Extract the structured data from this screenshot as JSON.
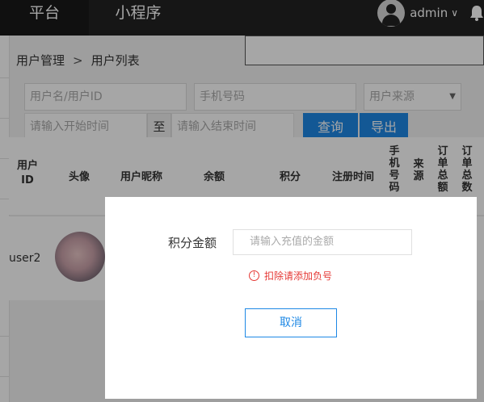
{
  "topnav": {
    "tabs": [
      {
        "label": "平台"
      },
      {
        "label": "小程序"
      }
    ],
    "user": {
      "name": "admin",
      "caret": "∨"
    }
  },
  "breadcrumb": {
    "parent": "用户管理",
    "separator": ">",
    "current": "用户列表"
  },
  "filters": {
    "username_placeholder": "用户名/用户ID",
    "phone_placeholder": "手机号码",
    "source_placeholder": "用户来源",
    "start_placeholder": "请输入开始时间",
    "to_label": "至",
    "end_placeholder": "请输入结束时间",
    "query_label": "查询",
    "export_label": "导出"
  },
  "table": {
    "headers": {
      "user_id": [
        "用户",
        "ID"
      ],
      "avatar": "头像",
      "nickname": "用户昵称",
      "balance": "余额",
      "points": "积分",
      "reg_time": "注册时间",
      "phone_v": [
        "手",
        "机",
        "号",
        "码"
      ],
      "source_v": [
        "来",
        "源"
      ],
      "order_total_v": [
        "订",
        "单",
        "总",
        "额"
      ],
      "order_count_v": [
        "订",
        "单",
        "总",
        "数"
      ]
    },
    "row": {
      "user": "user2"
    }
  },
  "modal": {
    "label": "积分金额",
    "input_placeholder": "请输入充值的金额",
    "warning": "扣除请添加负号",
    "warning_icon": "!",
    "cancel_label": "取消"
  },
  "colors": {
    "accent": "#1e88e5",
    "warning": "#e53935",
    "topbar": "#222222"
  }
}
